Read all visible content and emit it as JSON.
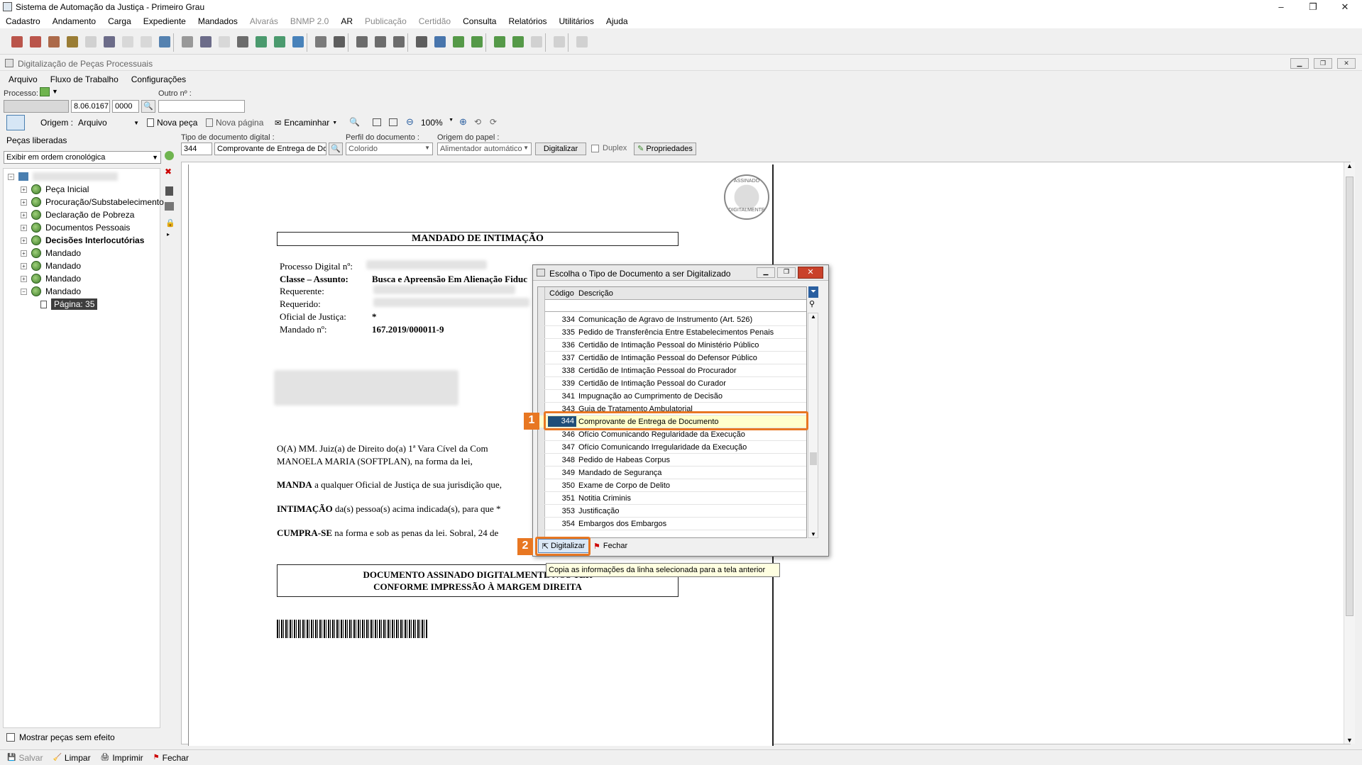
{
  "window": {
    "title": "Sistema de Automação da Justiça - Primeiro Grau"
  },
  "menu": [
    "Cadastro",
    "Andamento",
    "Carga",
    "Expediente",
    "Mandados",
    "Alvarás",
    "BNMP 2.0",
    "AR",
    "Publicação",
    "Certidão",
    "Consulta",
    "Relatórios",
    "Utilitários",
    "Ajuda"
  ],
  "menu_disabled": [
    "Alvarás",
    "BNMP 2.0",
    "Publicação",
    "Certidão"
  ],
  "child": {
    "title": "Digitalização de Peças Processuais",
    "submenu": [
      "Arquivo",
      "Fluxo de Trabalho",
      "Configurações"
    ],
    "processo_label": "Processo:",
    "outro_label": "Outro nº :",
    "processo_part2": "8.06.0167",
    "processo_part3": "0000",
    "origem_label": "Origem :",
    "origem_value": "Arquivo",
    "nova_peca": "Nova peça",
    "nova_pagina": "Nova página",
    "encaminhar": "Encaminhar",
    "zoom": "100%",
    "pecas_label": "Peças liberadas",
    "order_select": "Exibir em ordem cronológica",
    "tipo_label": "Tipo de documento digital :",
    "tipo_code": "344",
    "tipo_desc": "Comprovante de Entrega de Doc",
    "perfil_label": "Perfil do documento :",
    "perfil_value": "Colorido",
    "origem_papel_label": "Origem do papel :",
    "origem_papel_value": "Alimentador automático",
    "digitalizar_btn": "Digitalizar",
    "duplex": "Duplex",
    "propriedades": "Propriedades",
    "mostrar_pecas": "Mostrar peças sem efeito"
  },
  "tree": [
    {
      "label": "Peça Inicial",
      "bold": false
    },
    {
      "label": "Procuração/Substabelecimento",
      "bold": false
    },
    {
      "label": "Declaração de Pobreza",
      "bold": false
    },
    {
      "label": "Documentos Pessoais",
      "bold": false
    },
    {
      "label": "Decisões Interlocutórias",
      "bold": true
    },
    {
      "label": "Mandado",
      "bold": false
    },
    {
      "label": "Mandado",
      "bold": false
    },
    {
      "label": "Mandado",
      "bold": false
    },
    {
      "label": "Mandado",
      "bold": false
    }
  ],
  "tree_page": "Página: 35",
  "document": {
    "stamp_top": "ASSINADO",
    "stamp_bottom": "DIGITALMENTE",
    "title": "MANDADO DE INTIMAÇÃO",
    "processo_digital": "Processo Digital nº:",
    "classe_label": "Classe – Assunto:",
    "classe_value": "Busca e Apreensão Em Alienação Fiduc",
    "requerente": "Requerente:",
    "requerido": "Requerido:",
    "oficial": "Oficial de Justiça:",
    "oficial_value": "*",
    "mandado_label": "Mandado nº:",
    "mandado_value": "167.2019/000011-9",
    "para1": "O(A) MM. Juiz(a) de Direito do(a) 1ª Vara Cível da Com",
    "para1b": "MANOELA MARIA (SOFTPLAN), na forma da lei,",
    "para2_bold": "MANDA",
    "para2": " a qualquer Oficial de Justiça de sua jurisdição que,",
    "para3_bold": "INTIMAÇÃO",
    "para3": " da(s) pessoa(s) acima indicada(s), para que *",
    "para4_bold": "CUMPRA-SE",
    "para4": " na forma e sob as penas da lei. Sobral, 24 de",
    "box_line1": "DOCUMENTO ASSINADO DIGITALMENTE NOS TER",
    "box_line2": "CONFORME IMPRESSÃO À MARGEM DIREITA"
  },
  "dialog": {
    "title": "Escolha o Tipo de Documento a ser Digitalizado",
    "col_code": "Código",
    "col_desc": "Descrição",
    "rows": [
      {
        "code": "334",
        "desc": "Comunicação de Agravo de Instrumento (Art. 526)"
      },
      {
        "code": "335",
        "desc": "Pedido de Transferência Entre Estabelecimentos Penais"
      },
      {
        "code": "336",
        "desc": "Certidão de Intimação Pessoal do Ministério Público"
      },
      {
        "code": "337",
        "desc": "Certidão de Intimação Pessoal do Defensor Público"
      },
      {
        "code": "338",
        "desc": "Certidão de Intimação Pessoal do Procurador"
      },
      {
        "code": "339",
        "desc": "Certidão de Intimação Pessoal do Curador"
      },
      {
        "code": "341",
        "desc": "Impugnação ao Cumprimento de Decisão"
      },
      {
        "code": "343",
        "desc": "Guia de Tratamento Ambulatorial"
      },
      {
        "code": "344",
        "desc": "Comprovante de Entrega de Documento"
      },
      {
        "code": "346",
        "desc": "Ofício Comunicando Regularidade da Execução"
      },
      {
        "code": "347",
        "desc": "Ofício Comunicando Irregularidade da Execução"
      },
      {
        "code": "348",
        "desc": "Pedido de Habeas Corpus"
      },
      {
        "code": "349",
        "desc": "Mandado de Segurança"
      },
      {
        "code": "350",
        "desc": "Exame de Corpo de Delito"
      },
      {
        "code": "351",
        "desc": "Notitia Criminis"
      },
      {
        "code": "353",
        "desc": "Justificação"
      },
      {
        "code": "354",
        "desc": "Embargos dos Embargos"
      }
    ],
    "selected_code": "344",
    "digitalizar": "Digitalizar",
    "fechar": "Fechar",
    "callout1": "1",
    "callout2": "2",
    "tooltip": "Copia as informações da linha selecionada para a tela anterior"
  },
  "bottom": [
    "Salvar",
    "Limpar",
    "Imprimir",
    "Fechar"
  ],
  "colors": {
    "accent": "#e87722",
    "selection": "#1f4e79",
    "sel_row": "#ffffcc"
  }
}
